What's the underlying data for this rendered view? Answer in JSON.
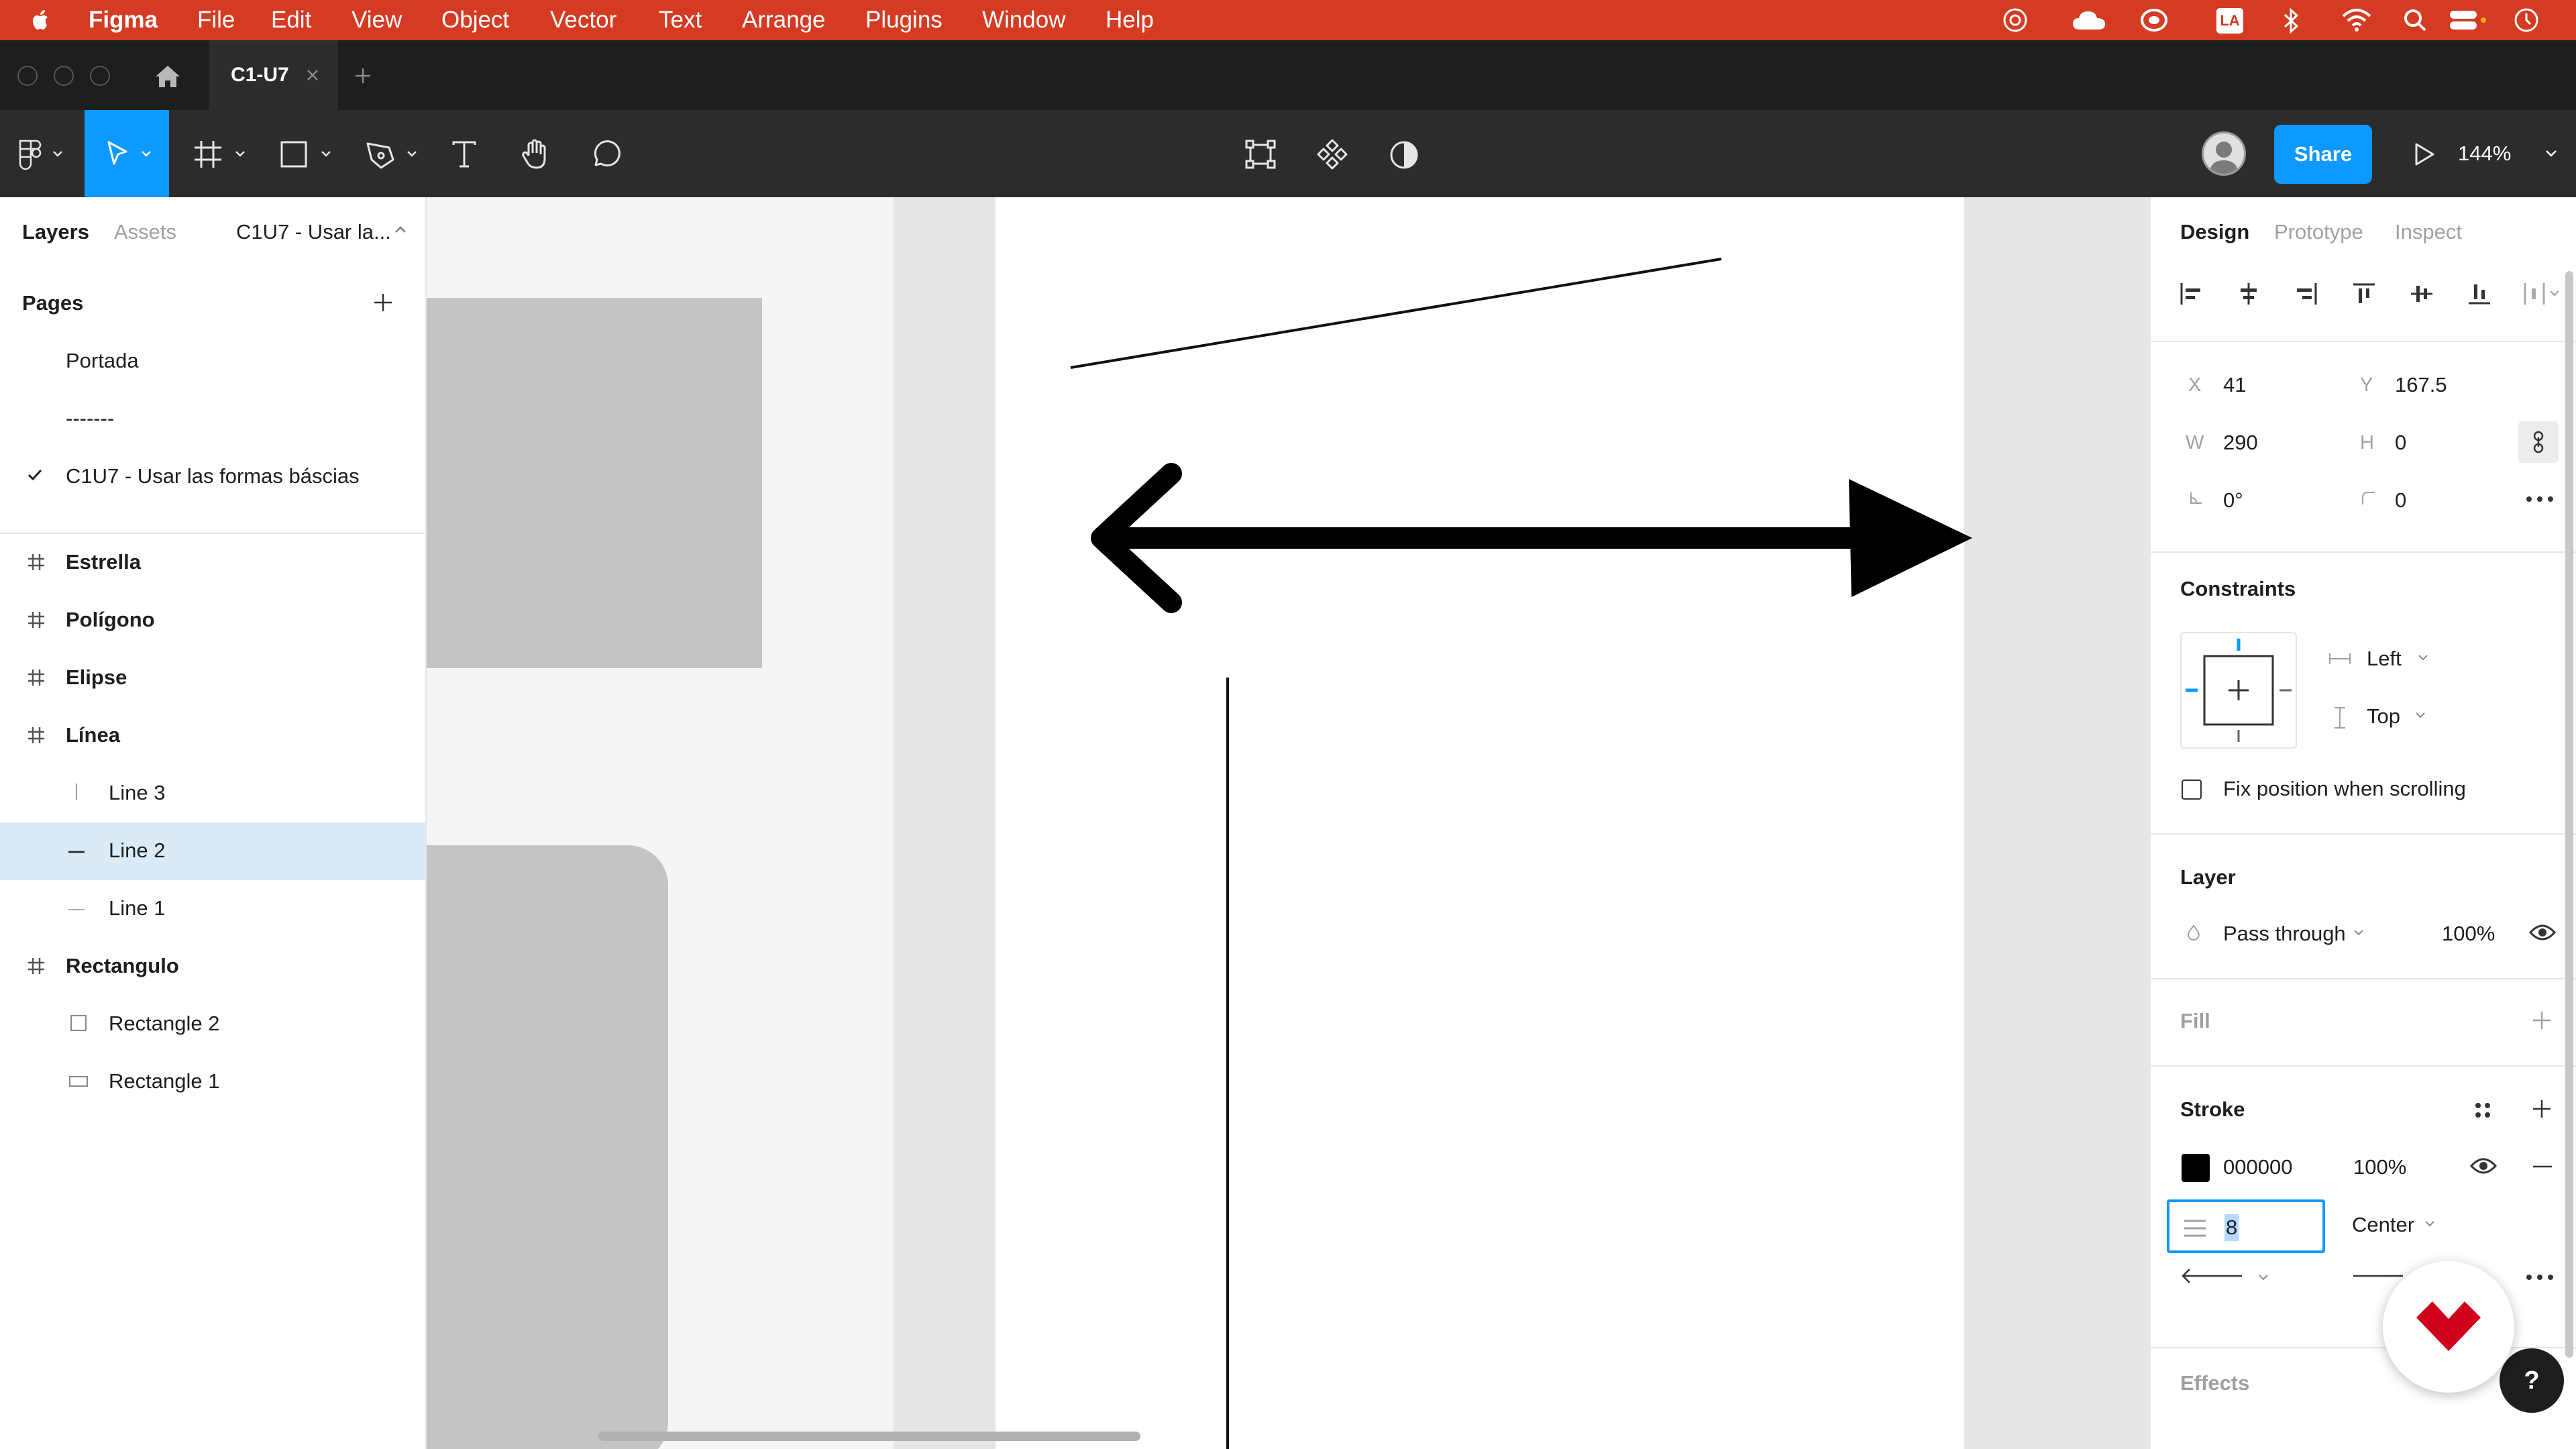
{
  "menubar": {
    "app_name": "Figma",
    "items": [
      "File",
      "Edit",
      "View",
      "Object",
      "Vector",
      "Text",
      "Arrange",
      "Plugins",
      "Window",
      "Help"
    ],
    "status_badge": "LA"
  },
  "tabbar": {
    "tab_title": "C1-U7"
  },
  "toolbar": {
    "share_label": "Share",
    "zoom_label": "144%"
  },
  "left_panel": {
    "tabs": [
      "Layers",
      "Assets"
    ],
    "page_selector_label": "C1U7 - Usar la...",
    "pages_header": "Pages",
    "pages": [
      "Portada",
      "-------",
      "C1U7 - Usar las formas báscias"
    ],
    "layers": [
      {
        "name": "Estrella",
        "type": "frame"
      },
      {
        "name": "Polígono",
        "type": "frame"
      },
      {
        "name": "Elipse",
        "type": "frame"
      },
      {
        "name": "Línea",
        "type": "frame"
      },
      {
        "name": "Line 3",
        "type": "vline"
      },
      {
        "name": "Line 2",
        "type": "hline",
        "selected": true
      },
      {
        "name": "Line 1",
        "type": "hline"
      },
      {
        "name": "Rectangulo",
        "type": "frame"
      },
      {
        "name": "Rectangle 2",
        "type": "rect"
      },
      {
        "name": "Rectangle 1",
        "type": "rect"
      }
    ]
  },
  "right_panel": {
    "tabs": [
      "Design",
      "Prototype",
      "Inspect"
    ],
    "props": {
      "x_label": "X",
      "x_value": "41",
      "y_label": "Y",
      "y_value": "167.5",
      "w_label": "W",
      "w_value": "290",
      "h_label": "H",
      "h_value": "0",
      "rotation_value": "0°",
      "radius_value": "0"
    },
    "constraints": {
      "header": "Constraints",
      "horizontal": "Left",
      "vertical": "Top",
      "fix_position_label": "Fix position when scrolling"
    },
    "layer": {
      "header": "Layer",
      "blend_mode": "Pass through",
      "opacity": "100%"
    },
    "fill": {
      "header": "Fill"
    },
    "stroke": {
      "header": "Stroke",
      "color_hex": "000000",
      "opacity": "100%",
      "weight": "8",
      "align": "Center"
    },
    "effects": {
      "header": "Effects"
    }
  },
  "colors": {
    "menubar_bg": "#d43b22",
    "share_button": "#0d99ff",
    "selected_row": "#daebf7",
    "stroke_swatch": "#000000",
    "brand_logo_red": "#d0021b"
  },
  "icons": {
    "help_badge": "?"
  }
}
